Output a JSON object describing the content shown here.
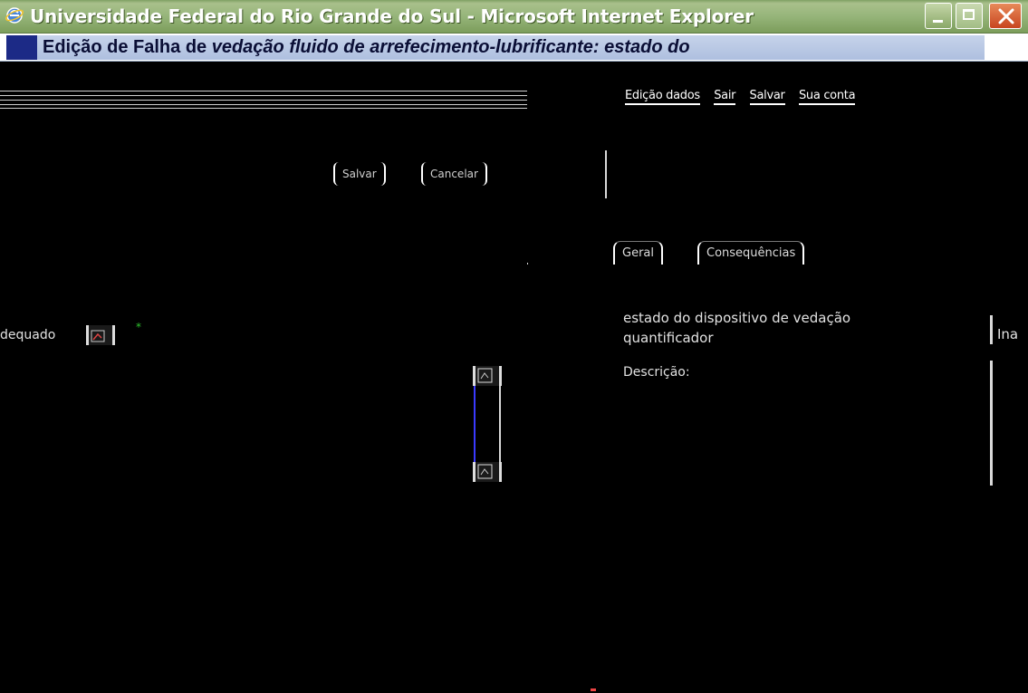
{
  "window": {
    "title": "Universidade Federal do Rio Grande do Sul - Microsoft Internet Explorer"
  },
  "page": {
    "heading_prefix": "Edição de Falha de ",
    "heading_italic": "vedação fluido de arrefecimento-lubrificante: estado do"
  },
  "toolbar": {
    "links": [
      "Edição dados",
      "Sair",
      "Salvar",
      "Sua conta"
    ]
  },
  "actions": {
    "save_label": "Salvar",
    "cancel_label": "Cancelar"
  },
  "tabs": [
    {
      "label": "Geral"
    },
    {
      "label": "Consequências"
    }
  ],
  "left_field": {
    "label": "dequado",
    "marker": "*"
  },
  "right_panel": {
    "item_line1": "estado do dispositivo de vedação",
    "item_line2": "quantificador",
    "side_label": "Ina",
    "description_label": "Descrição:"
  },
  "colors": {
    "titlebar": "#96b57a",
    "heading_band": "#aebfdf",
    "background": "#000000",
    "close_button": "#c8451f",
    "marker": "#2ec42e"
  }
}
